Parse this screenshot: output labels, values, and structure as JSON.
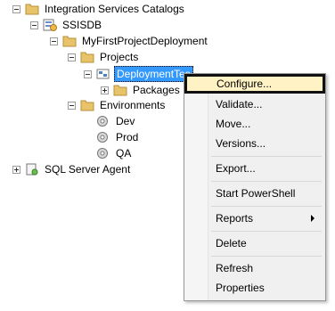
{
  "tree": {
    "integration_services_catalogs": "Integration Services Catalogs",
    "ssisdb": "SSISDB",
    "my_first_project_deployment": "MyFirstProjectDeployment",
    "projects": "Projects",
    "deployment_test": "DeploymentTes",
    "packages": "Packages",
    "environments": "Environments",
    "dev": "Dev",
    "prod": "Prod",
    "qa": "QA",
    "sql_server_agent": "SQL Server Agent"
  },
  "menu": {
    "configure": "Configure...",
    "validate": "Validate...",
    "move": "Move...",
    "versions": "Versions...",
    "export": "Export...",
    "start_powershell": "Start PowerShell",
    "reports": "Reports",
    "delete": "Delete",
    "refresh": "Refresh",
    "properties": "Properties"
  },
  "colors": {
    "selection": "#3399ff",
    "menu_highlight": "#fff3c5",
    "folder": "#e8c36a"
  }
}
